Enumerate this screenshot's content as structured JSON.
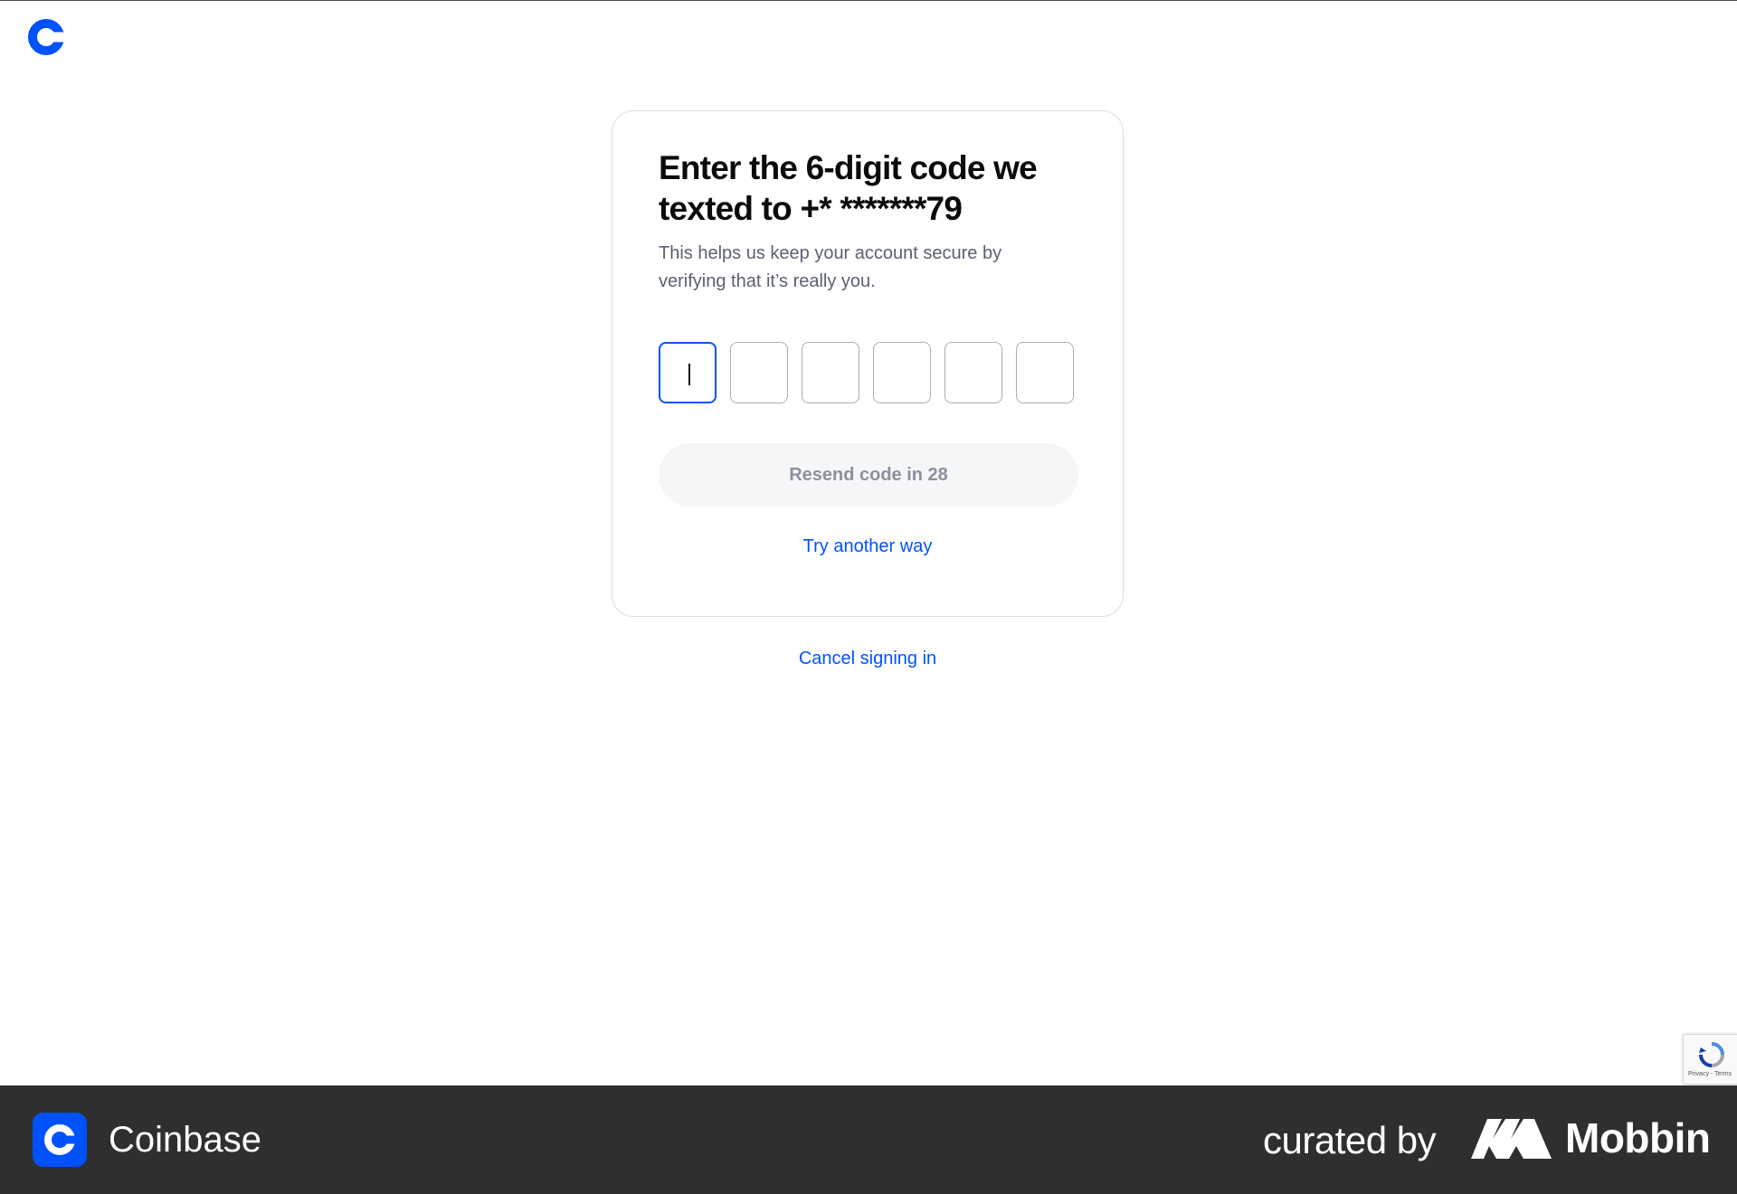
{
  "header": {
    "logo_icon": "coinbase-logo-icon",
    "brand_color": "#0052ff"
  },
  "verification": {
    "title": "Enter the 6-digit code we texted to +* *******79",
    "description": "This helps us keep your account secure by verifying that it’s really you.",
    "code_digits": [
      "",
      "",
      "",
      "",
      "",
      ""
    ],
    "resend_label": "Resend code in 28",
    "alternate_label": "Try another way"
  },
  "cancel_label": "Cancel signing in",
  "recaptcha": {
    "links_text": "Privacy - Terms",
    "icon": "recaptcha-icon"
  },
  "footer": {
    "brand_name": "Coinbase",
    "curated_text": "curated by",
    "curator_name": "Mobbin",
    "background": "#2f2f2f"
  }
}
